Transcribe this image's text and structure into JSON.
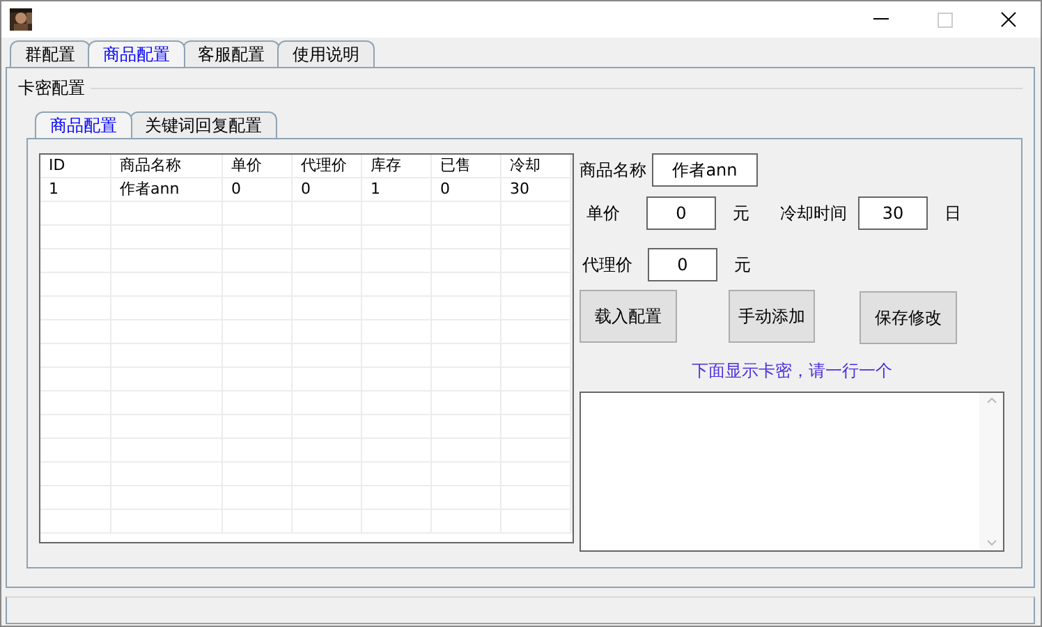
{
  "tabs": [
    {
      "label": "群配置",
      "selected": false
    },
    {
      "label": "商品配置",
      "selected": true
    },
    {
      "label": "客服配置",
      "selected": false
    },
    {
      "label": "使用说明",
      "selected": false
    }
  ],
  "group": {
    "title": "卡密配置"
  },
  "inner_tabs": [
    {
      "label": "商品配置",
      "selected": true
    },
    {
      "label": "关键词回复配置",
      "selected": false
    }
  ],
  "table": {
    "columns": [
      "ID",
      "商品名称",
      "单价",
      "代理价",
      "库存",
      "已售",
      "冷却"
    ],
    "rows": [
      [
        "1",
        "作者ann",
        "0",
        "0",
        "1",
        "0",
        "30"
      ]
    ]
  },
  "form": {
    "name_label": "商品名称",
    "name_value": "作者ann",
    "price_label": "单价",
    "price_value": "0",
    "price_unit": "元",
    "cooldown_label": "冷却时间",
    "cooldown_value": "30",
    "cooldown_unit": "日",
    "agent_label": "代理价",
    "agent_value": "0",
    "agent_unit": "元"
  },
  "buttons": [
    "载入配置",
    "手动添加",
    "保存修改"
  ],
  "hint": "下面显示卡密，请一行一个"
}
